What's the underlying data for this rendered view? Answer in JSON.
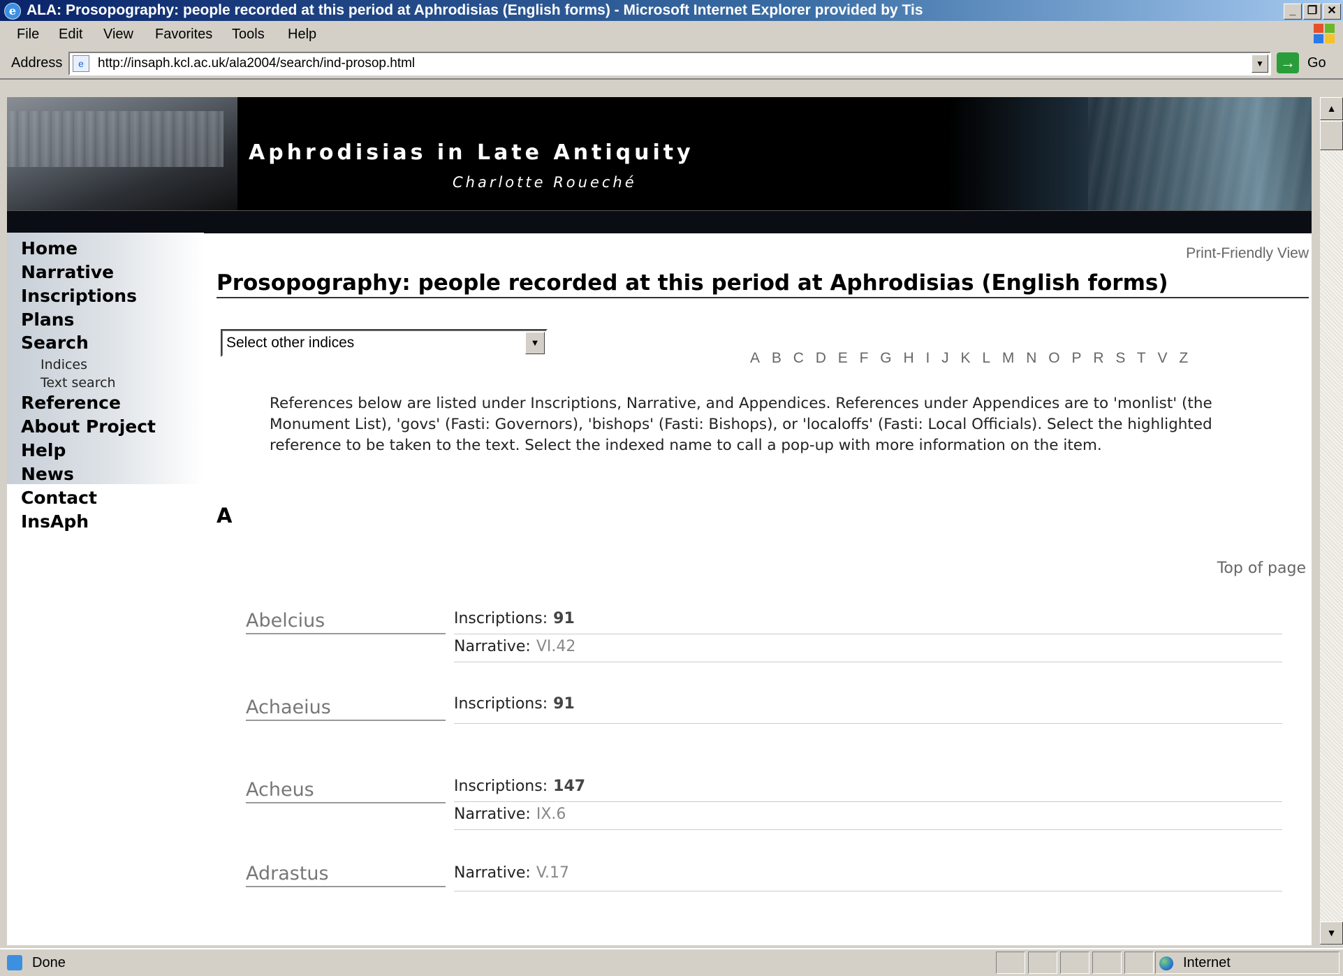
{
  "window": {
    "title": "ALA: Prosopography: people recorded at this period at Aphrodisias (English forms) - Microsoft Internet Explorer provided by Tis",
    "controls": [
      "_",
      "❐",
      "✕"
    ]
  },
  "menu": {
    "items": [
      "File",
      "Edit",
      "View",
      "Favorites",
      "Tools",
      "Help"
    ]
  },
  "address": {
    "label": "Address",
    "url": "http://insaph.kcl.ac.uk/ala2004/search/ind-prosop.html",
    "go_label": "Go"
  },
  "banner": {
    "title": "Aphrodisias in Late Antiquity",
    "author": "Charlotte Roueché"
  },
  "sidebar": {
    "items": [
      {
        "label": "Home"
      },
      {
        "label": "Narrative"
      },
      {
        "label": "Inscriptions"
      },
      {
        "label": "Plans"
      },
      {
        "label": "Search"
      },
      {
        "label": "Reference"
      },
      {
        "label": "About Project"
      },
      {
        "label": "Help"
      },
      {
        "label": "News"
      },
      {
        "label": "Contact"
      },
      {
        "label": "InsAph"
      }
    ],
    "subitems": [
      {
        "label": "Indices"
      },
      {
        "label": "Text search"
      }
    ]
  },
  "content": {
    "print_view": "Print-Friendly View",
    "page_title": "Prosopography: people recorded at this period at Aphrodisias (English forms)",
    "select_value": "Select other indices",
    "letters": [
      "A",
      "B",
      "C",
      "D",
      "E",
      "F",
      "G",
      "H",
      "I",
      "J",
      "K",
      "L",
      "M",
      "N",
      "O",
      "P",
      "R",
      "S",
      "T",
      "V",
      "Z"
    ],
    "intro": "References below are listed under Inscriptions, Narrative, and Appendices. References under Appendices are to 'monlist' (the Monument List), 'govs' (Fasti: Governors), 'bishops' (Fasti: Bishops), or 'localoffs' (Fasti: Local Officials). Select the highlighted reference to be taken to the text. Select the indexed name to call a pop-up with more information on the item.",
    "section_letter": "A",
    "top_of_page": "Top of page",
    "entries": [
      {
        "name": "Abelcius",
        "refs": [
          {
            "label": "Inscriptions:",
            "value": "91"
          },
          {
            "label": "Narrative:",
            "value": "VI.42"
          }
        ]
      },
      {
        "name": "Achaeius",
        "refs": [
          {
            "label": "Inscriptions:",
            "value": "91"
          }
        ]
      },
      {
        "name": "Acheus",
        "refs": [
          {
            "label": "Inscriptions:",
            "value": "147"
          },
          {
            "label": "Narrative:",
            "value": "IX.6"
          }
        ]
      },
      {
        "name": "Adrastus",
        "refs": [
          {
            "label": "Narrative:",
            "value": "V.17"
          }
        ]
      }
    ]
  },
  "status": {
    "text": "Done",
    "zone": "Internet"
  }
}
